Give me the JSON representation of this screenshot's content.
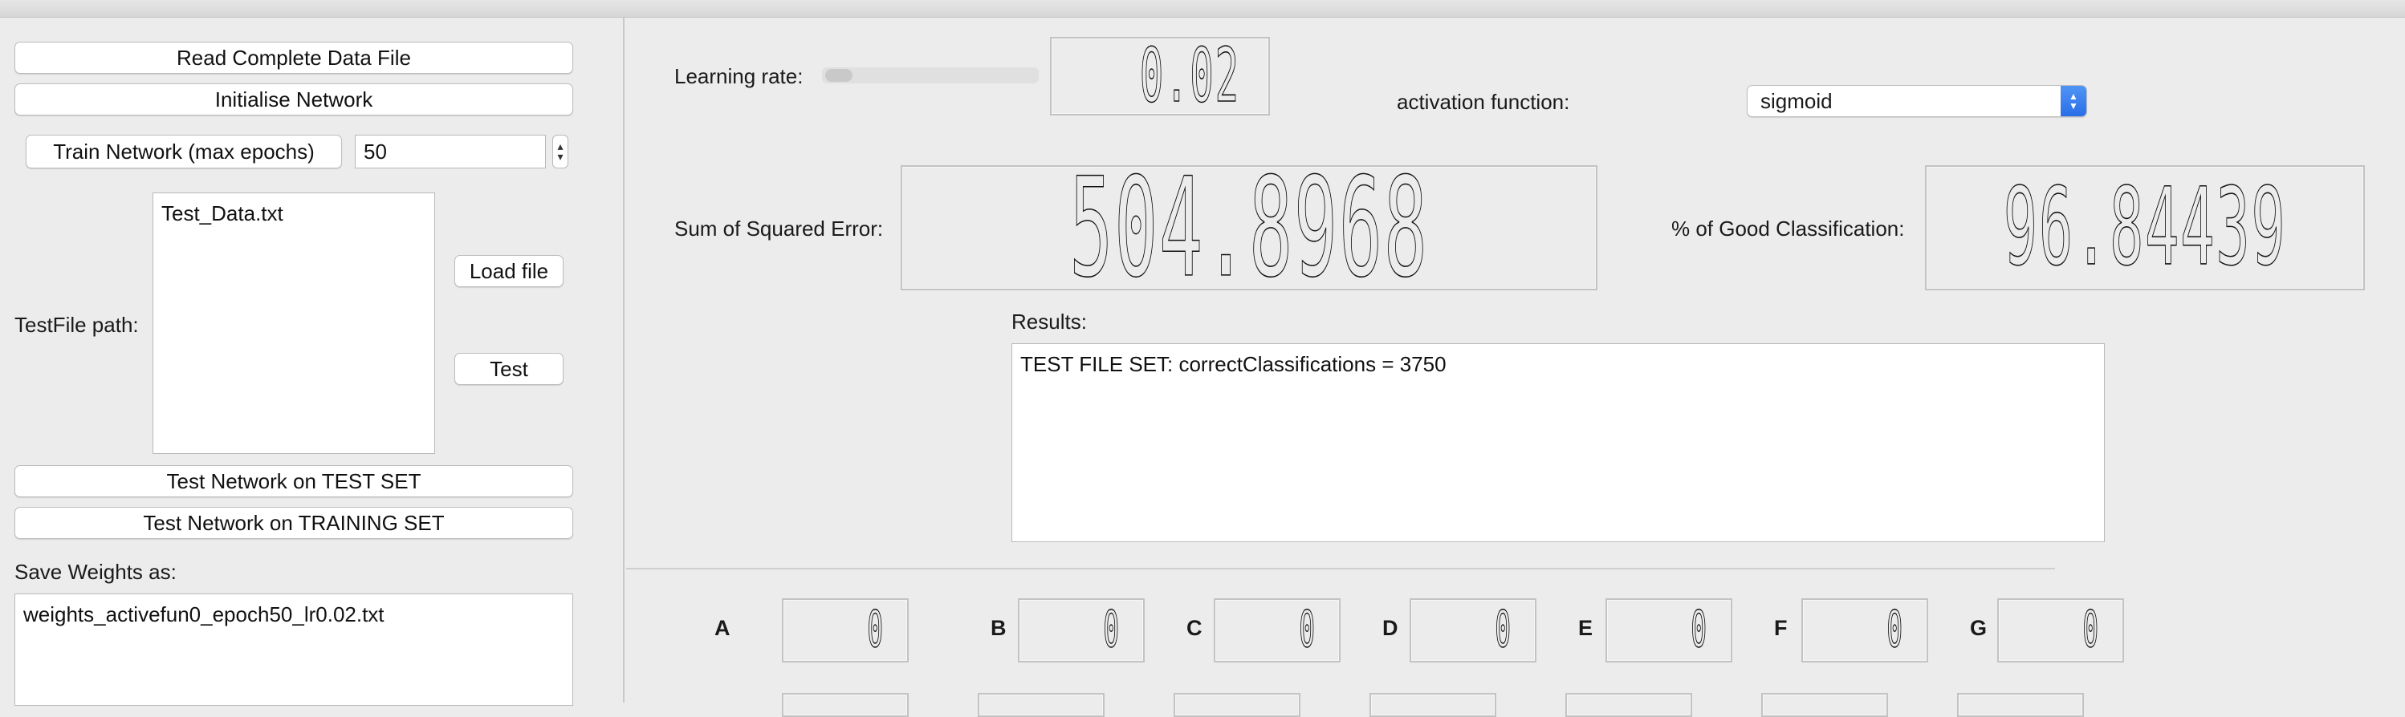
{
  "left": {
    "read_button": "Read Complete Data File",
    "init_button": "Initialise Network",
    "train_button": "Train Network (max epochs)",
    "epochs_value": "50",
    "testfile_label": "TestFile path:",
    "testfile_value": "Test_Data.txt",
    "load_button": "Load file",
    "test_button": "Test",
    "test_set_button": "Test Network on TEST SET",
    "training_set_button": "Test Network on TRAINING SET",
    "save_label": "Save Weights as:",
    "save_value": "weights_activefun0_epoch50_lr0.02.txt"
  },
  "main": {
    "learning_rate_label": "Learning rate:",
    "learning_rate_value": "0.02",
    "learning_rate_slider_fraction": 0.02,
    "activation_label": "activation function:",
    "activation_value": "sigmoid",
    "sse_label": "Sum of Squared Error:",
    "sse_value": "504.8968",
    "good_label": "% of Good Classification:",
    "good_value": "96.84439",
    "results_label": "Results:",
    "results_text": "TEST FILE SET: correctClassifications = 3750"
  },
  "counters": [
    {
      "letter": "A",
      "value": "0"
    },
    {
      "letter": "B",
      "value": "0"
    },
    {
      "letter": "C",
      "value": "0"
    },
    {
      "letter": "D",
      "value": "0"
    },
    {
      "letter": "E",
      "value": "0"
    },
    {
      "letter": "F",
      "value": "0"
    },
    {
      "letter": "G",
      "value": "0"
    }
  ]
}
